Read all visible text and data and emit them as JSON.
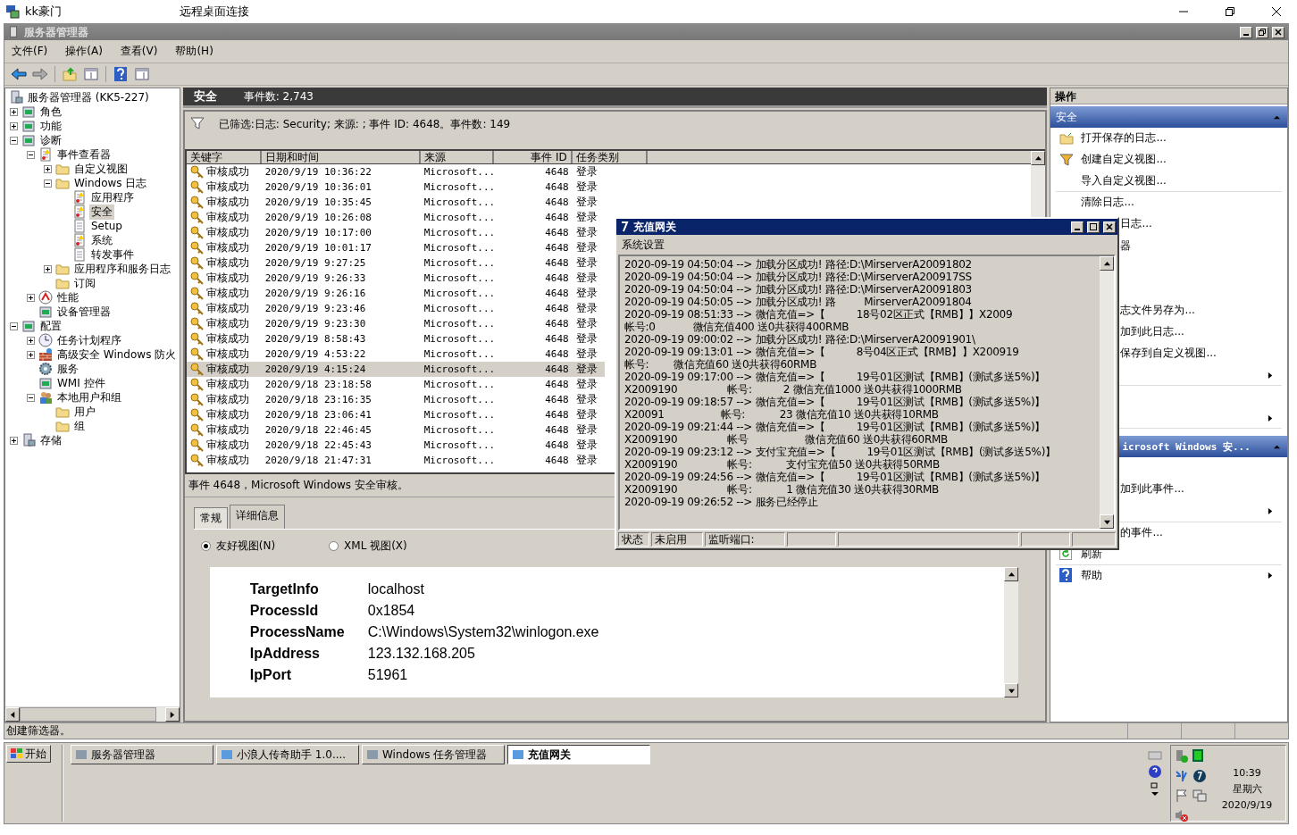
{
  "remote_desktop": {
    "title_left": "kk豪门",
    "title_right": "远程桌面连接"
  },
  "window": {
    "title": "服务器管理器"
  },
  "menu": [
    "文件(F)",
    "操作(A)",
    "查看(V)",
    "帮助(H)"
  ],
  "tree": [
    {
      "label": "服务器管理器 (KK5-227)",
      "kind": "server",
      "selected": false,
      "children": [
        {
          "label": "角色",
          "kind": "tool",
          "selected": false,
          "expanded": false
        },
        {
          "label": "功能",
          "kind": "tool",
          "selected": false,
          "expanded": false
        },
        {
          "label": "诊断",
          "kind": "tool",
          "selected": false,
          "expanded": true,
          "children": [
            {
              "label": "事件查看器",
              "kind": "log",
              "selected": false,
              "expanded": true,
              "children": [
                {
                  "label": "自定义视图",
                  "kind": "folder",
                  "selected": false,
                  "expanded": false
                },
                {
                  "label": "Windows 日志",
                  "kind": "folder",
                  "selected": false,
                  "expanded": true,
                  "children": [
                    {
                      "label": "应用程序",
                      "kind": "log",
                      "selected": false
                    },
                    {
                      "label": "安全",
                      "kind": "log",
                      "selected": true
                    },
                    {
                      "label": "Setup",
                      "kind": "page",
                      "selected": false
                    },
                    {
                      "label": "系统",
                      "kind": "log",
                      "selected": false
                    },
                    {
                      "label": "转发事件",
                      "kind": "page",
                      "selected": false
                    }
                  ]
                },
                {
                  "label": "应用程序和服务日志",
                  "kind": "folder",
                  "selected": false,
                  "expanded": false
                },
                {
                  "label": "订阅",
                  "kind": "folder",
                  "selected": false
                }
              ]
            },
            {
              "label": "性能",
              "kind": "gauge",
              "selected": false,
              "expanded": false
            },
            {
              "label": "设备管理器",
              "kind": "tool",
              "selected": false
            }
          ]
        },
        {
          "label": "配置",
          "kind": "tool",
          "selected": false,
          "expanded": true,
          "children": [
            {
              "label": "任务计划程序",
              "kind": "clock",
              "selected": false,
              "expanded": false
            },
            {
              "label": "高级安全 Windows 防火",
              "kind": "wall",
              "selected": false,
              "expanded": false
            },
            {
              "label": "服务",
              "kind": "gear",
              "selected": false
            },
            {
              "label": "WMI 控件",
              "kind": "tool",
              "selected": false
            },
            {
              "label": "本地用户和组",
              "kind": "users",
              "selected": false,
              "expanded": true,
              "children": [
                {
                  "label": "用户",
                  "kind": "folder",
                  "selected": false
                },
                {
                  "label": "组",
                  "kind": "folder",
                  "selected": false
                }
              ]
            }
          ]
        },
        {
          "label": "存储",
          "kind": "server",
          "selected": false,
          "expanded": false
        }
      ]
    }
  ],
  "log_header": {
    "title": "安全",
    "count": "事件数: 2,743"
  },
  "filter": "已筛选:日志: Security; 来源: ; 事件 ID: 4648。事件数: 149",
  "table": {
    "columns": [
      "关键字",
      "日期和时间",
      "来源",
      "事件 ID",
      "任务类别"
    ],
    "rows": [
      {
        "keyword": "审核成功",
        "datetime": "2020/9/19 10:36:22",
        "source": "Microsoft...",
        "event_id": "4648",
        "task": "登录",
        "selected": false
      },
      {
        "keyword": "审核成功",
        "datetime": "2020/9/19 10:36:01",
        "source": "Microsoft...",
        "event_id": "4648",
        "task": "登录",
        "selected": false
      },
      {
        "keyword": "审核成功",
        "datetime": "2020/9/19 10:35:45",
        "source": "Microsoft...",
        "event_id": "4648",
        "task": "登录",
        "selected": false
      },
      {
        "keyword": "审核成功",
        "datetime": "2020/9/19 10:26:08",
        "source": "Microsoft...",
        "event_id": "4648",
        "task": "登录",
        "selected": false
      },
      {
        "keyword": "审核成功",
        "datetime": "2020/9/19 10:17:00",
        "source": "Microsoft...",
        "event_id": "4648",
        "task": "登录",
        "selected": false
      },
      {
        "keyword": "审核成功",
        "datetime": "2020/9/19 10:01:17",
        "source": "Microsoft...",
        "event_id": "4648",
        "task": "登录",
        "selected": false
      },
      {
        "keyword": "审核成功",
        "datetime": "2020/9/19 9:27:25",
        "source": "Microsoft...",
        "event_id": "4648",
        "task": "登录",
        "selected": false
      },
      {
        "keyword": "审核成功",
        "datetime": "2020/9/19 9:26:33",
        "source": "Microsoft...",
        "event_id": "4648",
        "task": "登录",
        "selected": false
      },
      {
        "keyword": "审核成功",
        "datetime": "2020/9/19 9:26:16",
        "source": "Microsoft...",
        "event_id": "4648",
        "task": "登录",
        "selected": false
      },
      {
        "keyword": "审核成功",
        "datetime": "2020/9/19 9:23:46",
        "source": "Microsoft...",
        "event_id": "4648",
        "task": "登录",
        "selected": false
      },
      {
        "keyword": "审核成功",
        "datetime": "2020/9/19 9:23:30",
        "source": "Microsoft...",
        "event_id": "4648",
        "task": "登录",
        "selected": false
      },
      {
        "keyword": "审核成功",
        "datetime": "2020/9/19 8:58:43",
        "source": "Microsoft...",
        "event_id": "4648",
        "task": "登录",
        "selected": false
      },
      {
        "keyword": "审核成功",
        "datetime": "2020/9/19 4:53:22",
        "source": "Microsoft...",
        "event_id": "4648",
        "task": "登录",
        "selected": false
      },
      {
        "keyword": "审核成功",
        "datetime": "2020/9/19 4:15:24",
        "source": "Microsoft...",
        "event_id": "4648",
        "task": "登录",
        "selected": true
      },
      {
        "keyword": "审核成功",
        "datetime": "2020/9/18 23:18:58",
        "source": "Microsoft...",
        "event_id": "4648",
        "task": "登录",
        "selected": false
      },
      {
        "keyword": "审核成功",
        "datetime": "2020/9/18 23:16:35",
        "source": "Microsoft...",
        "event_id": "4648",
        "task": "登录",
        "selected": false
      },
      {
        "keyword": "审核成功",
        "datetime": "2020/9/18 23:06:41",
        "source": "Microsoft...",
        "event_id": "4648",
        "task": "登录",
        "selected": false
      },
      {
        "keyword": "审核成功",
        "datetime": "2020/9/18 22:46:45",
        "source": "Microsoft...",
        "event_id": "4648",
        "task": "登录",
        "selected": false
      },
      {
        "keyword": "审核成功",
        "datetime": "2020/9/18 22:45:43",
        "source": "Microsoft...",
        "event_id": "4648",
        "task": "登录",
        "selected": false
      },
      {
        "keyword": "审核成功",
        "datetime": "2020/9/18 21:47:31",
        "source": "Microsoft...",
        "event_id": "4648",
        "task": "登录",
        "selected": false
      }
    ]
  },
  "event_detail": {
    "title": "事件 4648，Microsoft Windows 安全审核。",
    "tabs": [
      {
        "label": "常规",
        "selected": false
      },
      {
        "label": "详细信息",
        "selected": true
      }
    ],
    "views": [
      {
        "label": "友好视图(N)",
        "selected": true
      },
      {
        "label": "XML 视图(X)",
        "selected": false
      }
    ],
    "fields": [
      {
        "name": "TargetInfo",
        "value": "localhost"
      },
      {
        "name": "ProcessId",
        "value": "0x1854"
      },
      {
        "name": "ProcessName",
        "value": "C:\\Windows\\System32\\winlogon.exe"
      },
      {
        "name": "IpAddress",
        "value": "123.132.168.205"
      },
      {
        "name": "IpPort",
        "value": "51961"
      }
    ]
  },
  "actions": {
    "title": "操作",
    "items": [
      {
        "kind": "section",
        "label": "安全"
      },
      {
        "kind": "action",
        "label": "打开保存的日志...",
        "submenu": false
      },
      {
        "kind": "action",
        "label": "创建自定义视图...",
        "submenu": false
      },
      {
        "kind": "action",
        "label": "导入自定义视图...",
        "submenu": false
      },
      {
        "kind": "action",
        "label": "清除日志...",
        "submenu": false
      },
      {
        "kind": "covered",
        "label": "日志...",
        "submenu": false
      },
      {
        "kind": "covered",
        "label": "器",
        "submenu": false
      },
      {
        "kind": "blank"
      },
      {
        "kind": "blank"
      },
      {
        "kind": "covered",
        "label": "志文件另存为...",
        "submenu": false
      },
      {
        "kind": "covered",
        "label": "加到此日志...",
        "submenu": false
      },
      {
        "kind": "covered",
        "label": "保存到自定义视图...",
        "submenu": false
      },
      {
        "kind": "blank",
        "submenu": true
      },
      {
        "kind": "blank"
      },
      {
        "kind": "blank",
        "submenu": true
      },
      {
        "kind": "covered_section",
        "label": "icrosoft Windows 安..."
      },
      {
        "kind": "blank"
      },
      {
        "kind": "covered",
        "label": "加到此事件...",
        "submenu": false
      },
      {
        "kind": "blank",
        "submenu": true
      },
      {
        "kind": "covered",
        "label": "的事件...",
        "submenu": false
      },
      {
        "kind": "action",
        "label": "刷新",
        "submenu": false
      },
      {
        "kind": "action",
        "label": "帮助",
        "submenu": true
      }
    ]
  },
  "status_bar": "创建筛选器。",
  "dialog": {
    "title": "充值网关",
    "menu": "系统设置",
    "log": [
      "2020-09-19 04:50:04 --> 加载分区成功! 路径:D:\\MirserverA20091802",
      "2020-09-19 04:50:04 --> 加载分区成功! 路径:D:\\MirserverA200917SS",
      "2020-09-19 04:50:04 --> 加载分区成功! 路径:D:\\MirserverA20091803",
      "2020-09-19 04:50:05 --> 加载分区成功! 路         MirserverA20091804",
      "2020-09-19 08:51:33 --> 微信充值=>【          18号02区正式【RMB】】X2009",
      "帐号:0            微信充值400 送0共获得400RMB",
      "2020-09-19 09:00:02 --> 加载分区成功! 路径:D:\\MirserverA20091901\\",
      "2020-09-19 09:13:01 --> 微信充值=>【          8号04区正式【RMB】】X200919",
      "帐号:        微信充值60 送0共获得60RMB",
      "2020-09-19 09:17:00 --> 微信充值=>【          19号01区测试【RMB】(测试多送5%)】",
      "X2009190                帐号:          2 微信充值1000 送0共获得1000RMB",
      "2020-09-19 09:18:57 --> 微信充值=>【          19号01区测试【RMB】(测试多送5%)】",
      "X20091                  帐号:           23 微信充值10 送0共获得10RMB",
      "2020-09-19 09:21:44 --> 微信充值=>【          19号01区测试【RMB】(测试多送5%)】",
      "X2009190                帐号                  微信充值60 送0共获得60RMB",
      "2020-09-19 09:23:12 --> 支付宝充值=>【          19号01区测试【RMB】(测试多送5%)】",
      "X2009190                帐号:           支付宝充值50 送0共获得50RMB",
      "2020-09-19 09:24:56 --> 微信充值=>【          19号01区测试【RMB】(测试多送5%)】",
      "X2009190                帐号:           1 微信充值30 送0共获得30RMB",
      "2020-09-19 09:26:52 --> 服务已经停止"
    ],
    "status": [
      "状态",
      "未启用",
      "监听端口:"
    ]
  },
  "taskbar": {
    "start": "开始",
    "buttons": [
      {
        "label": "服务器管理器",
        "selected": false
      },
      {
        "label": "小浪人传奇助手 1.0....",
        "selected": false
      },
      {
        "label": "Windows 任务管理器",
        "selected": false
      },
      {
        "label": "充值网关",
        "selected": true
      }
    ],
    "clock": {
      "time": "10:39",
      "weekday": "星期六",
      "date": "2020/9/19"
    }
  }
}
